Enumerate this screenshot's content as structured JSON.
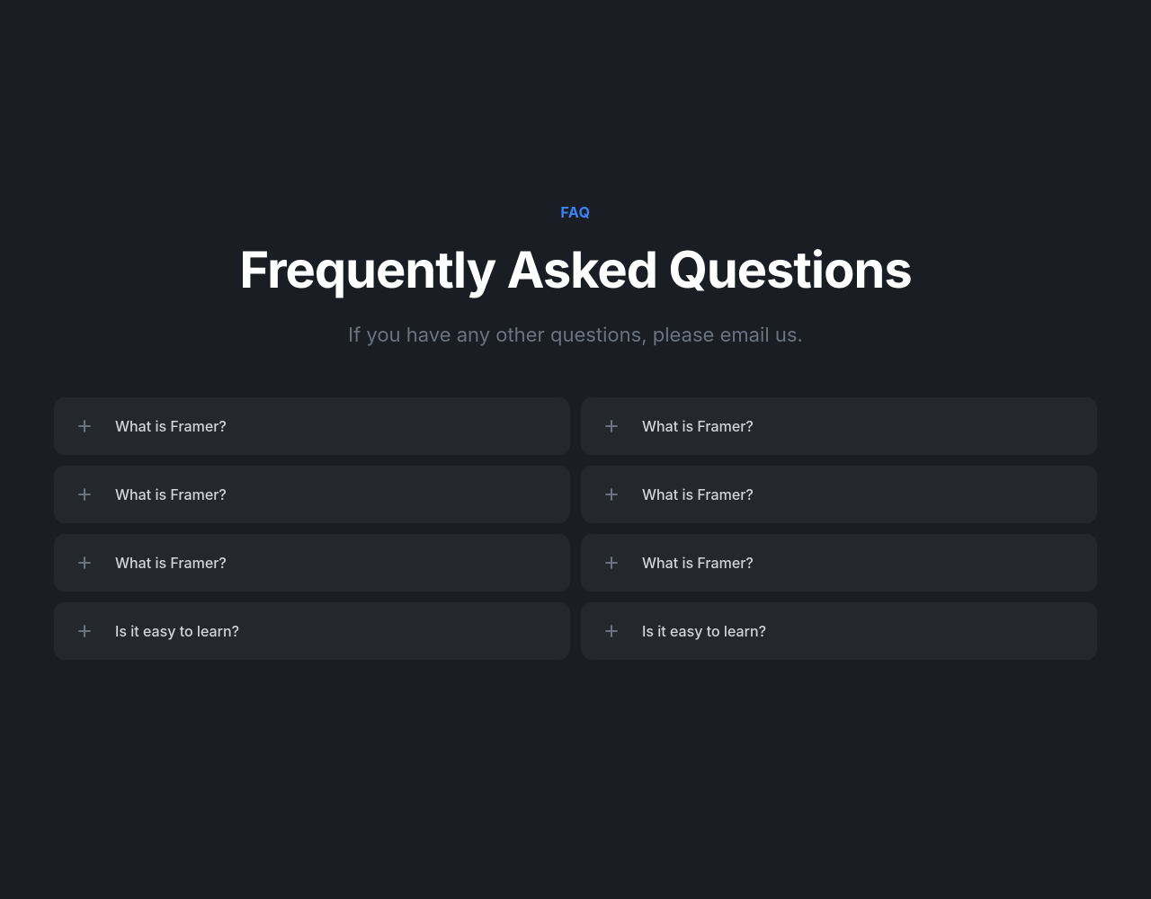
{
  "header": {
    "eyebrow": "FAQ",
    "title": "Frequently Asked Questions",
    "subtitle": "If you have any other questions, please email us."
  },
  "faq": {
    "left": [
      {
        "question": "What is Framer?"
      },
      {
        "question": "What is Framer?"
      },
      {
        "question": "What is Framer?"
      },
      {
        "question": "Is it easy to learn?"
      }
    ],
    "right": [
      {
        "question": "What is Framer?"
      },
      {
        "question": "What is Framer?"
      },
      {
        "question": "What is Framer?"
      },
      {
        "question": "Is it easy to learn?"
      }
    ]
  }
}
